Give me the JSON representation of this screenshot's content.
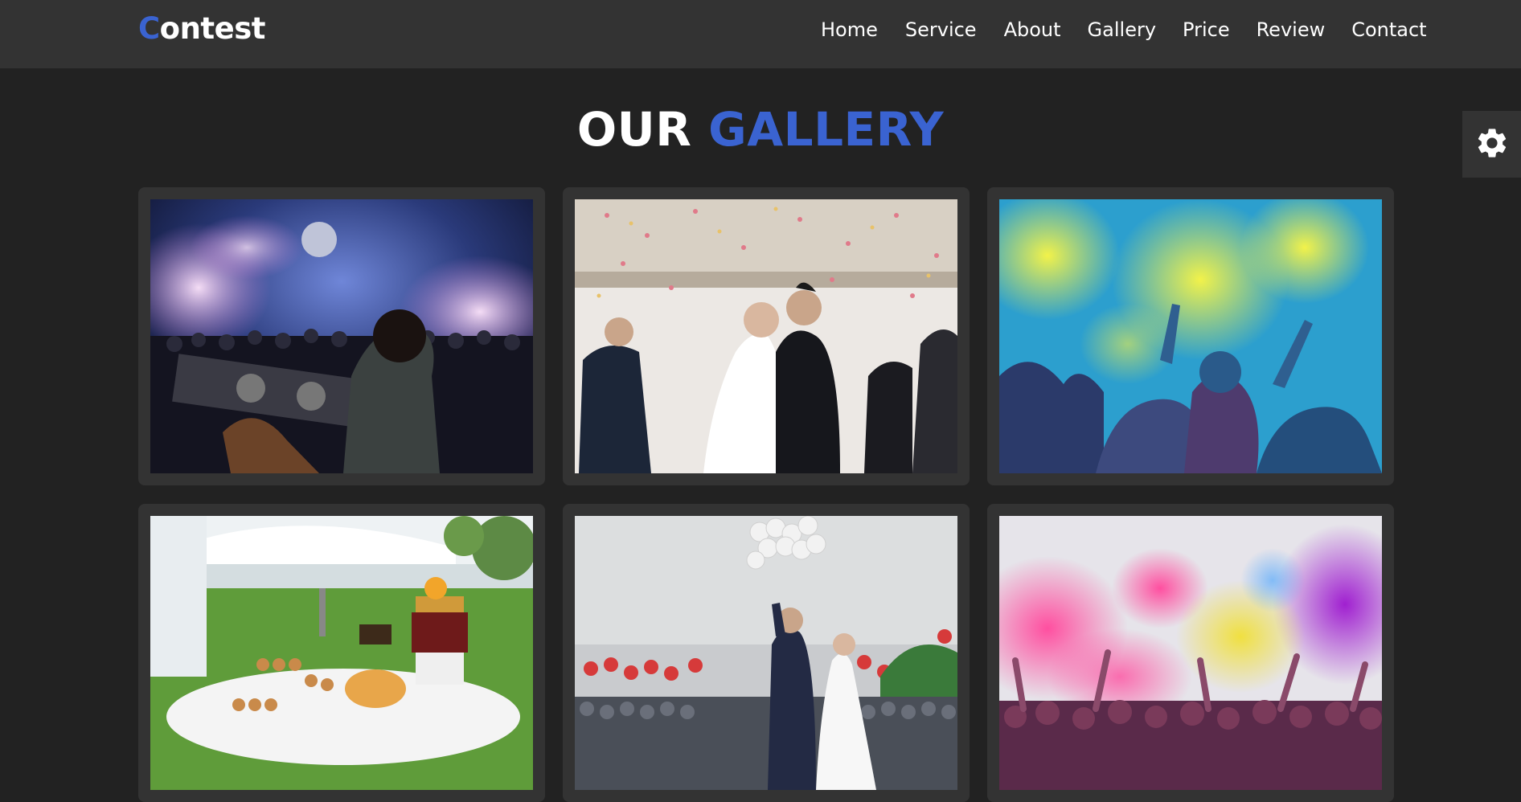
{
  "header": {
    "logo_first_letter": "C",
    "logo_rest": "ontest",
    "nav": [
      {
        "label": "Home"
      },
      {
        "label": "Service"
      },
      {
        "label": "About"
      },
      {
        "label": "Gallery"
      },
      {
        "label": "Price"
      },
      {
        "label": "Review"
      },
      {
        "label": "Contact"
      }
    ]
  },
  "section": {
    "title_first": "OUR",
    "title_accent": "GALLERY"
  },
  "settings": {
    "icon": "gear-icon"
  },
  "gallery": [
    {
      "subject": "dj-party-photo"
    },
    {
      "subject": "wedding-confetti-photo"
    },
    {
      "subject": "color-powder-festival-photo"
    },
    {
      "subject": "dessert-table-photo"
    },
    {
      "subject": "wedding-balloons-photo"
    },
    {
      "subject": "holi-crowd-photo"
    }
  ],
  "colors": {
    "accent": "#3a63d1",
    "background": "#222222",
    "panel": "#333333",
    "text": "#ffffff"
  }
}
